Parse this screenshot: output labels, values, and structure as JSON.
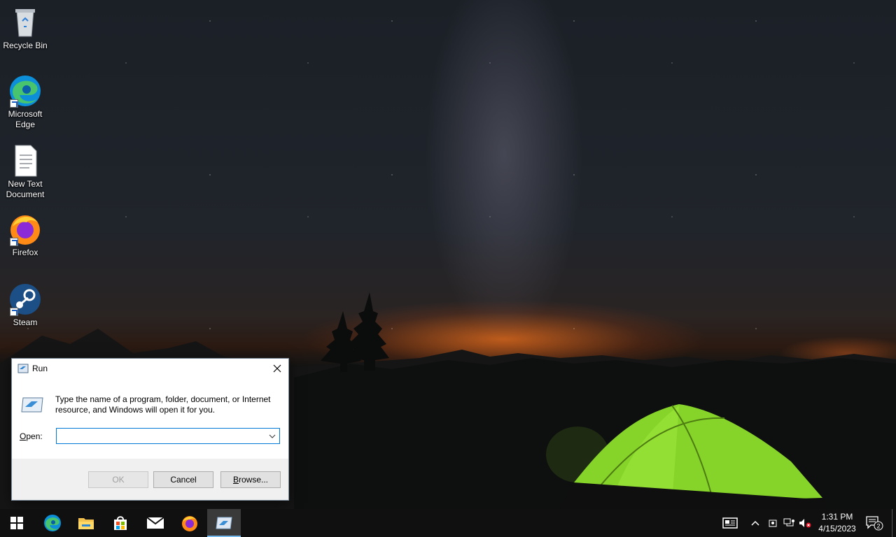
{
  "desktop": {
    "icons": [
      {
        "label": "Recycle Bin",
        "icon": "recycle-bin-icon"
      },
      {
        "label": "Microsoft Edge",
        "icon": "edge-icon"
      },
      {
        "label": "New Text Document",
        "icon": "text-document-icon"
      },
      {
        "label": "Firefox",
        "icon": "firefox-icon"
      },
      {
        "label": "Steam",
        "icon": "steam-icon"
      }
    ]
  },
  "run_dialog": {
    "title": "Run",
    "description": "Type the name of a program, folder, document, or Internet resource, and Windows will open it for you.",
    "open_label_prefix": "",
    "open_label_accel": "O",
    "open_label_rest": "pen:",
    "open_value": "",
    "ok_label": "OK",
    "cancel_label": "Cancel",
    "browse_label_accel": "B",
    "browse_label_rest": "rowse..."
  },
  "taskbar": {
    "pinned": [
      "start-icon",
      "edge-icon",
      "file-explorer-icon",
      "store-icon",
      "mail-icon",
      "firefox-icon",
      "run-icon"
    ],
    "active": "run-icon",
    "clock_time": "1:31 PM",
    "clock_date": "4/15/2023",
    "notification_count": "2"
  },
  "colors": {
    "accent": "#0078d7",
    "taskbar": "#101010",
    "active_indicator": "#76b9ed"
  }
}
